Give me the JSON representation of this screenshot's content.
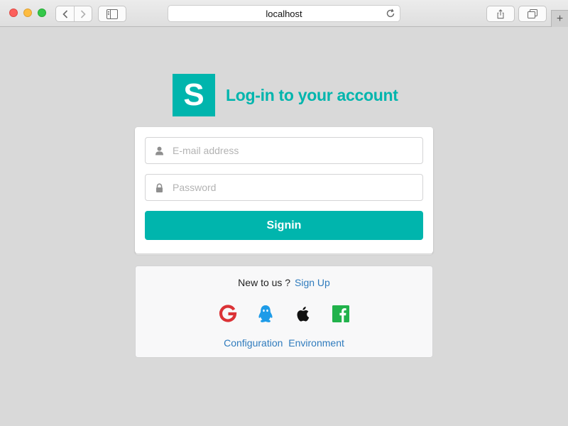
{
  "browser": {
    "address": "localhost",
    "new_tab_label": "+"
  },
  "header": {
    "logo_letter": "S",
    "title": "Log-in to your account"
  },
  "form": {
    "email_placeholder": "E-mail address",
    "email_value": "",
    "password_placeholder": "Password",
    "password_value": "",
    "signin_label": "Signin"
  },
  "message": {
    "new_text": "New to us ?",
    "signup_label": "Sign Up",
    "socials": [
      "google-icon",
      "qq-icon",
      "apple-icon",
      "facebook-icon"
    ],
    "configuration_label": "Configuration",
    "environment_label": "Environment"
  },
  "colors": {
    "accent": "#00b5ad",
    "link": "#2f7bbd",
    "google": "#db3236",
    "qq": "#1d9be8",
    "apple": "#111111",
    "facebook_green": "#21b24b"
  }
}
